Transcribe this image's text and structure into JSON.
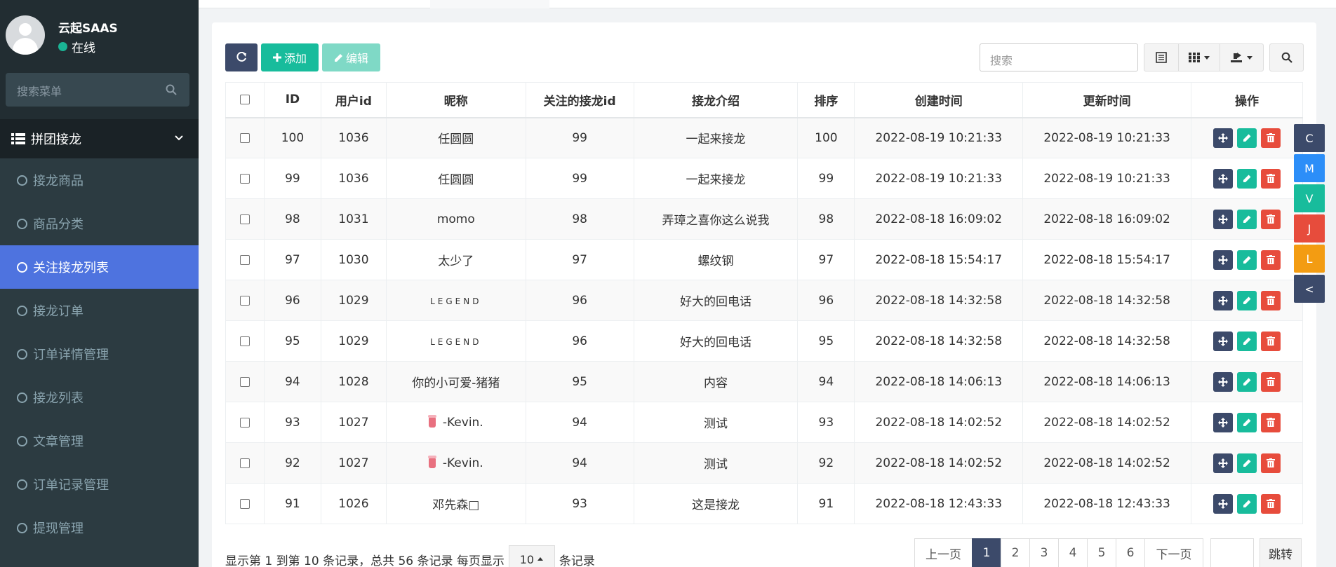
{
  "user": {
    "name": "云起SAAS",
    "status": "在线"
  },
  "sidebar": {
    "search_placeholder": "搜索菜单",
    "group": "拼团接龙",
    "items": [
      {
        "label": "接龙商品",
        "active": false
      },
      {
        "label": "商品分类",
        "active": false
      },
      {
        "label": "关注接龙列表",
        "active": true
      },
      {
        "label": "接龙订单",
        "active": false
      },
      {
        "label": "订单详情管理",
        "active": false
      },
      {
        "label": "接龙列表",
        "active": false
      },
      {
        "label": "文章管理",
        "active": false
      },
      {
        "label": "订单记录管理",
        "active": false
      },
      {
        "label": "提现管理",
        "active": false
      }
    ]
  },
  "toolbar": {
    "add_label": "添加",
    "edit_label": "编辑",
    "search_placeholder": "搜索"
  },
  "table": {
    "headers": [
      "ID",
      "用户id",
      "昵称",
      "关注的接龙id",
      "接龙介绍",
      "排序",
      "创建时间",
      "更新时间",
      "操作"
    ],
    "rows": [
      {
        "id": "100",
        "uid": "1036",
        "nick": "任圆圆",
        "follow": "99",
        "intro": "一起来接龙",
        "sort": "100",
        "created": "2022-08-19 10:21:33",
        "updated": "2022-08-19 10:21:33"
      },
      {
        "id": "99",
        "uid": "1036",
        "nick": "任圆圆",
        "follow": "99",
        "intro": "一起来接龙",
        "sort": "99",
        "created": "2022-08-19 10:21:33",
        "updated": "2022-08-19 10:21:33"
      },
      {
        "id": "98",
        "uid": "1031",
        "nick": "momo",
        "follow": "98",
        "intro": "弄璋之喜你这么说我",
        "sort": "98",
        "created": "2022-08-18 16:09:02",
        "updated": "2022-08-18 16:09:02"
      },
      {
        "id": "97",
        "uid": "1030",
        "nick": "太少了",
        "follow": "97",
        "intro": "螺纹钢",
        "sort": "97",
        "created": "2022-08-18 15:54:17",
        "updated": "2022-08-18 15:54:17"
      },
      {
        "id": "96",
        "uid": "1029",
        "nick": "LEGEND",
        "follow": "96",
        "intro": "好大的回电话",
        "sort": "96",
        "created": "2022-08-18 14:32:58",
        "updated": "2022-08-18 14:32:58"
      },
      {
        "id": "95",
        "uid": "1029",
        "nick": "LEGEND",
        "follow": "96",
        "intro": "好大的回电话",
        "sort": "95",
        "created": "2022-08-18 14:32:58",
        "updated": "2022-08-18 14:32:58"
      },
      {
        "id": "94",
        "uid": "1028",
        "nick": "你的小可爱-猪猪",
        "follow": "95",
        "intro": "内容",
        "sort": "94",
        "created": "2022-08-18 14:06:13",
        "updated": "2022-08-18 14:06:13"
      },
      {
        "id": "93",
        "uid": "1027",
        "nick": "-Kevin.",
        "follow": "94",
        "intro": "测试",
        "sort": "93",
        "created": "2022-08-18 14:02:52",
        "updated": "2022-08-18 14:02:52"
      },
      {
        "id": "92",
        "uid": "1027",
        "nick": "-Kevin.",
        "follow": "94",
        "intro": "测试",
        "sort": "92",
        "created": "2022-08-18 14:02:52",
        "updated": "2022-08-18 14:02:52"
      },
      {
        "id": "91",
        "uid": "1026",
        "nick": "邓先森□",
        "follow": "93",
        "intro": "这是接龙",
        "sort": "91",
        "created": "2022-08-18 12:43:33",
        "updated": "2022-08-18 12:43:33"
      }
    ]
  },
  "float_buttons": [
    {
      "label": "C",
      "color": "#3c4a6a"
    },
    {
      "label": "M",
      "color": "#2c8ef8"
    },
    {
      "label": "V",
      "color": "#18bc9c"
    },
    {
      "label": "J",
      "color": "#e74c3c"
    },
    {
      "label": "L",
      "color": "#f39c12"
    },
    {
      "label": "<",
      "color": "#3c4a6a"
    }
  ],
  "footer": {
    "info_prefix": "显示第 1 到第 10 条记录，总共 56 条记录 每页显示",
    "page_size": "10",
    "info_suffix": "条记录",
    "prev": "上一页",
    "next": "下一页",
    "pages": [
      "1",
      "2",
      "3",
      "4",
      "5",
      "6"
    ],
    "current_page": "1",
    "jump": "跳转"
  }
}
